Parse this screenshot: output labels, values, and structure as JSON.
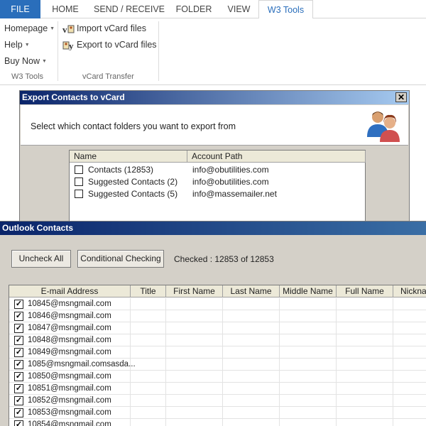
{
  "ribbon": {
    "tabs": [
      "FILE",
      "HOME",
      "SEND / RECEIVE",
      "FOLDER",
      "VIEW",
      "W3 Tools"
    ],
    "w3tools_group": {
      "items": [
        "Homepage",
        "Help",
        "Buy Now"
      ],
      "label": "W3 Tools"
    },
    "vcard_group": {
      "import_label": "Import vCard files",
      "export_label": "Export to vCard files",
      "import_icon_text": "v",
      "export_icon_text": "y",
      "label": "vCard Transfer"
    }
  },
  "export_dialog": {
    "title": "Export Contacts to vCard",
    "close_symbol": "✕",
    "instruction": "Select which contact folders you want to export from",
    "columns": [
      "Name",
      "Account Path"
    ],
    "rows": [
      {
        "name": "Contacts (12853)",
        "account": "info@obutilities.com",
        "checked": false
      },
      {
        "name": "Suggested Contacts (2)",
        "account": "info@obutilities.com",
        "checked": false
      },
      {
        "name": "Suggested Contacts (5)",
        "account": "info@massemailer.net",
        "checked": false
      }
    ]
  },
  "outlook_contacts": {
    "title": "Outlook Contacts",
    "uncheck_all": "Uncheck All",
    "conditional_checking": "Conditional Checking",
    "checked_status": "Checked : 12853 of 12853",
    "columns": [
      "E-mail Address",
      "Title",
      "First Name",
      "Last Name",
      "Middle Name",
      "Full Name",
      "Nicknam"
    ],
    "check_mark": "✓",
    "rows": [
      "10845@msngmail.com",
      "10846@msngmail.com",
      "10847@msngmail.com",
      "10848@msngmail.com",
      "10849@msngmail.com",
      "1085@msngmail.comsasda...",
      "10850@msngmail.com",
      "10851@msngmail.com",
      "10852@msngmail.com",
      "10853@msngmail.com",
      "10854@msngmail.com"
    ]
  },
  "colors": {
    "file_tab": "#2a6ebb",
    "title_bar": "#0a246a",
    "dialog_bg": "#d4d0c8"
  }
}
